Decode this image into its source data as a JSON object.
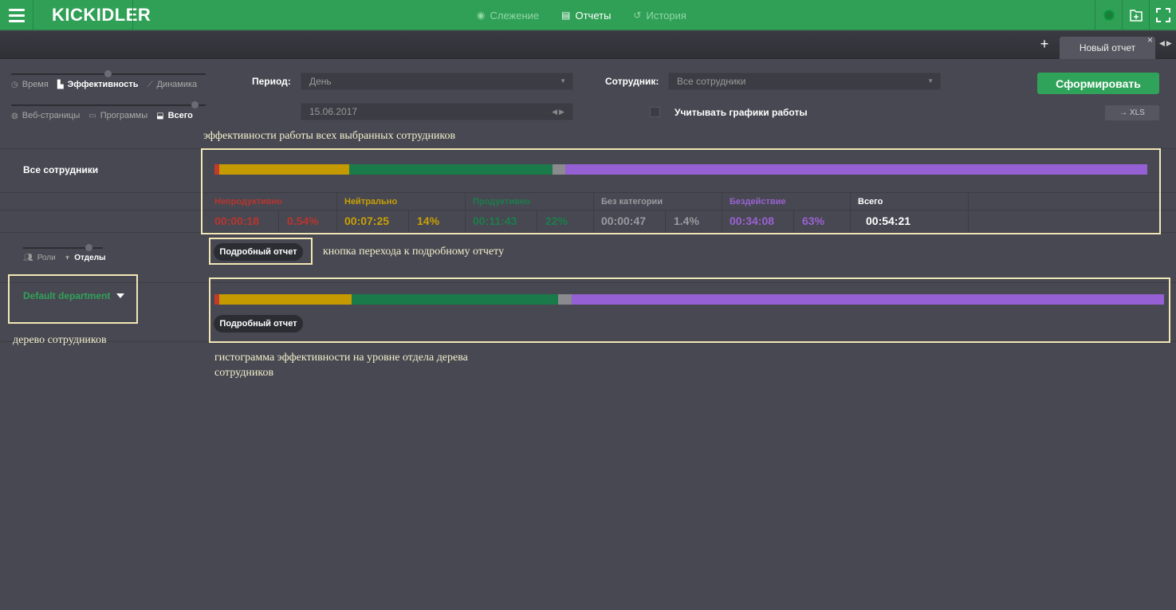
{
  "app": {
    "logo": "KICKIDLER"
  },
  "nav": [
    {
      "label": "Слежение",
      "icon": "eye-icon",
      "active": false
    },
    {
      "label": "Отчеты",
      "icon": "document-icon",
      "active": true
    },
    {
      "label": "История",
      "icon": "history-icon",
      "active": false
    }
  ],
  "tabs": {
    "active_label": "Новый отчет"
  },
  "modes": {
    "row1": [
      "Время",
      "Эффективность",
      "Динамика"
    ],
    "row1_active": "Эффективность",
    "row2": [
      "Веб-страницы",
      "Программы",
      "Всего"
    ],
    "row2_active": "Всего"
  },
  "filters": {
    "period_label": "Период:",
    "period_value": "День",
    "date_value": "15.06.2017",
    "employee_label": "Сотрудник:",
    "employee_value": "Все сотрудники",
    "schedule_checkbox_label": "Учитывать графики работы",
    "schedule_checked": false,
    "generate_button": "Сформировать",
    "xls_button": "→ XLS"
  },
  "summary": {
    "row_title": "Все сотрудники",
    "bar_fractions": {
      "unproductive": 0.0054,
      "neutral": 0.14,
      "productive": 0.22,
      "uncategorized": 0.014,
      "idle": 0.63
    },
    "stats": [
      {
        "label": "Непродуктивно",
        "time": "00:00:18",
        "percent": "0.54%",
        "color": "#b8352f"
      },
      {
        "label": "Нейтрально",
        "time": "00:07:25",
        "percent": "14%",
        "color": "#c9a006"
      },
      {
        "label": "Продуктивно",
        "time": "00:11:43",
        "percent": "22%",
        "color": "#1c7d4c"
      },
      {
        "label": "Без категории",
        "time": "00:00:47",
        "percent": "1.4%",
        "color": "#9a9aa0"
      },
      {
        "label": "Бездействие",
        "time": "00:34:08",
        "percent": "63%",
        "color": "#9a62d3"
      }
    ],
    "total_label": "Всего",
    "total_time": "00:54:21"
  },
  "group_modes": {
    "options": [
      "Роли",
      "Отделы"
    ],
    "active": "Отделы"
  },
  "detail_button": "Подробный отчет",
  "department": {
    "name": "Default department",
    "detail_button": "Подробный отчет"
  },
  "annotations": {
    "summary_note": "эффективности работы всех выбранных сотрудников",
    "detail_button_note": "кнопка перехода к подробному отчету",
    "tree_note": "дерево сотрудников",
    "histogram_note_line1": "гистограмма эффективности на уровне отдела дерева",
    "histogram_note_line2": "сотрудников"
  },
  "colors": {
    "accent_green": "#2fa055",
    "unproductive": "#c43a2a",
    "neutral": "#c49a00",
    "productive": "#1a7a4a",
    "uncategorized": "#8a8a8f",
    "idle": "#9560d3"
  }
}
